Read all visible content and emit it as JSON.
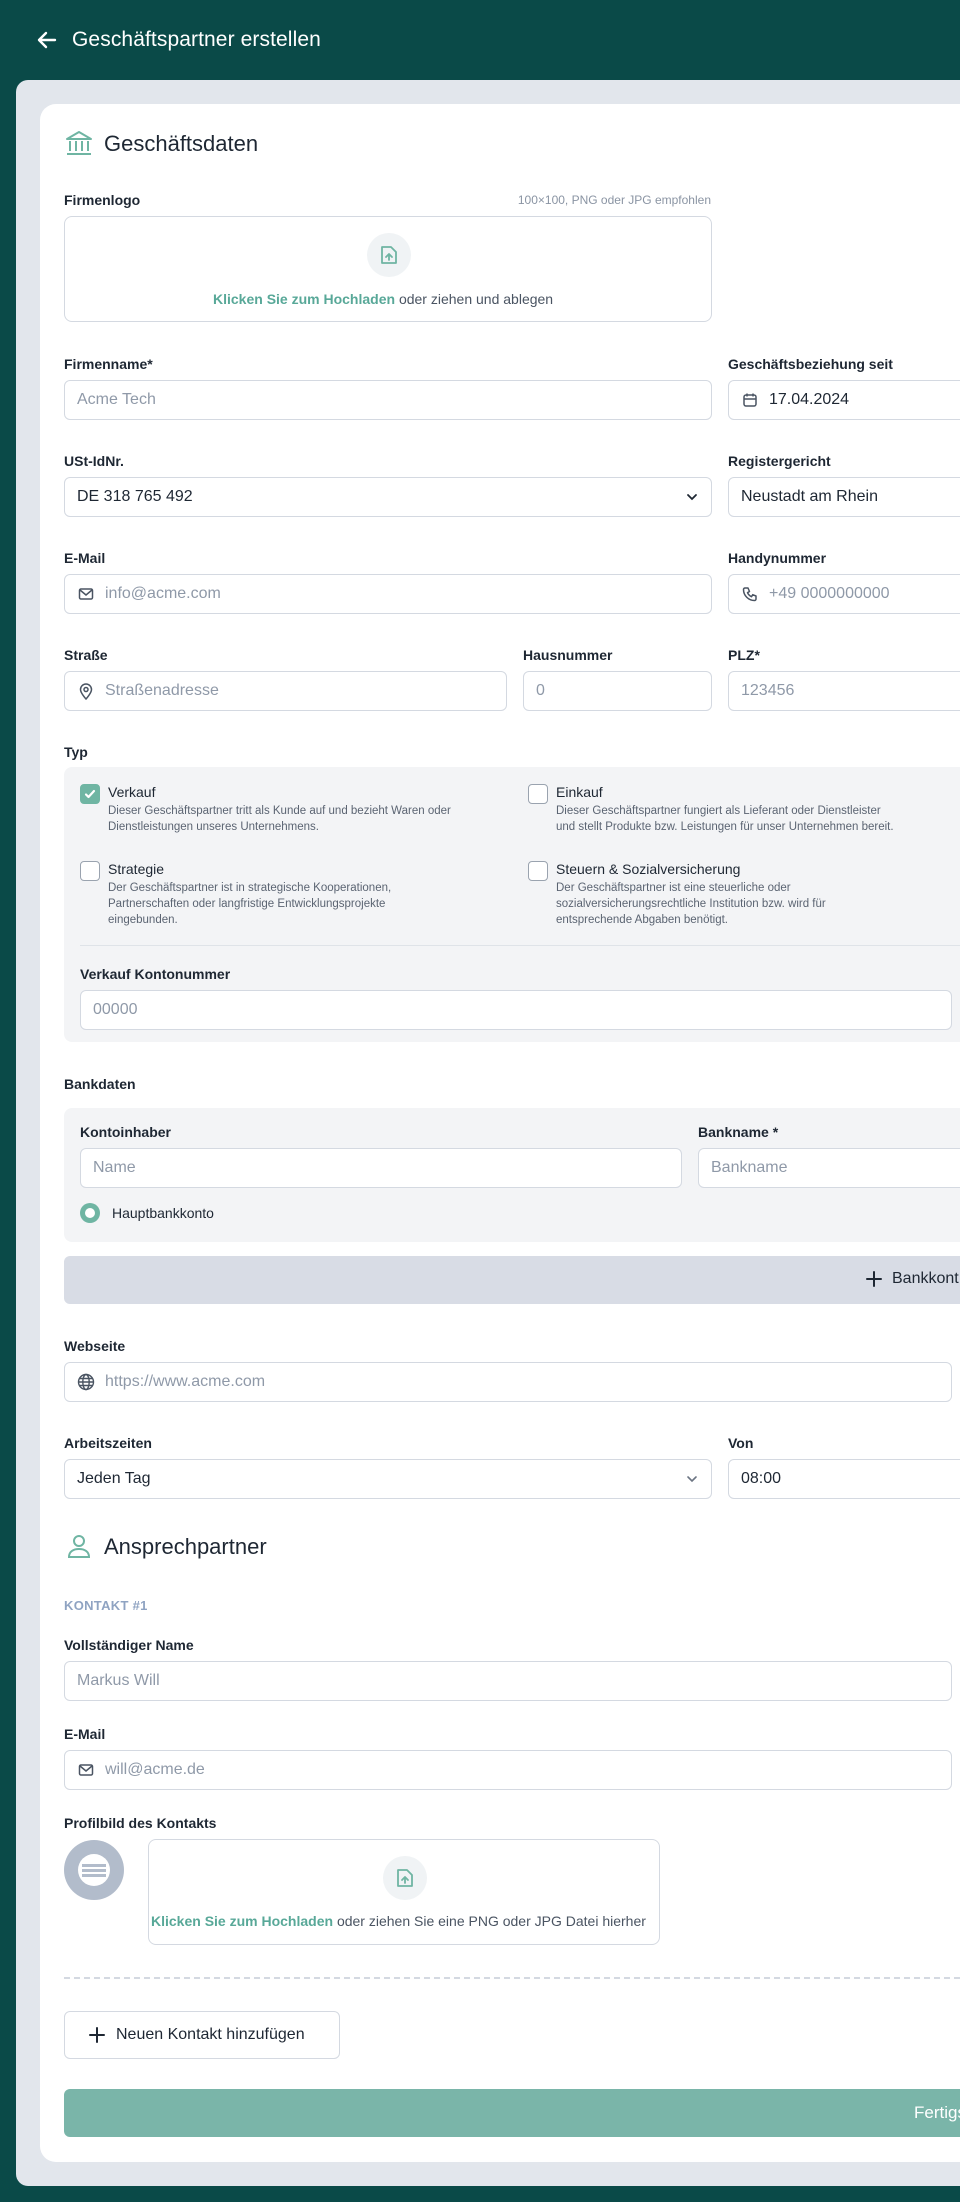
{
  "header": {
    "title": "Geschäftspartner erstellen"
  },
  "business": {
    "section_title": "Geschäftsdaten",
    "logo": {
      "label": "Firmenlogo",
      "hint": "100×100, PNG oder JPG empfohlen",
      "link": "Klicken Sie zum Hochladen",
      "text": " oder ziehen und ablegen"
    },
    "company_name": {
      "label": "Firmenname*",
      "placeholder": "Acme Tech"
    },
    "relation_since": {
      "label": "Geschäftsbeziehung seit",
      "value": "17.04.2024"
    },
    "vat": {
      "label": "USt-IdNr.",
      "value": "DE 318 765 492"
    },
    "register_court": {
      "label": "Registergericht",
      "value": "Neustadt am Rhein"
    },
    "email": {
      "label": "E-Mail",
      "placeholder": "info@acme.com"
    },
    "mobile": {
      "label": "Handynummer",
      "placeholder": "+49 0000000000"
    },
    "street": {
      "label": "Straße",
      "placeholder": "Straßenadresse"
    },
    "house_number": {
      "label": "Hausnummer",
      "placeholder": "0"
    },
    "zip": {
      "label": "PLZ*",
      "placeholder": "123456"
    }
  },
  "type": {
    "label": "Typ",
    "options": [
      {
        "name": "Verkauf",
        "checked": true,
        "desc1": "Dieser Geschäftspartner tritt als Kunde auf und bezieht Waren oder",
        "desc2": "Dienstleistungen unseres Unternehmens.",
        "desc3": ""
      },
      {
        "name": "Einkauf",
        "checked": false,
        "desc1": "Dieser Geschäftspartner fungiert als Lieferant oder Dienstleister",
        "desc2": "und stellt Produkte bzw. Leistungen für unser Unternehmen bereit.",
        "desc3": ""
      },
      {
        "name": "Strategie",
        "checked": false,
        "desc1": "Der Geschäftspartner ist in strategische Kooperationen,",
        "desc2": "Partnerschaften oder langfristige Entwicklungsprojekte",
        "desc3": "eingebunden."
      },
      {
        "name": "Steuern & Sozialversicherung",
        "checked": false,
        "desc1": "Der Geschäftspartner ist eine steuerliche oder",
        "desc2": "sozialversicherungsrechtliche Institution bzw. wird für",
        "desc3": "entsprechende Abgaben benötigt."
      }
    ],
    "account": {
      "label": "Verkauf Kontonummer",
      "placeholder": "00000"
    }
  },
  "bank": {
    "label": "Bankdaten",
    "holder": {
      "label": "Kontoinhaber",
      "placeholder": "Name"
    },
    "bank_name": {
      "label": "Bankname *",
      "placeholder": "Bankname"
    },
    "main_account": "Hauptbankkonto",
    "add_label": "Bankkont"
  },
  "website": {
    "label": "Webseite",
    "placeholder": "https://www.acme.com"
  },
  "hours": {
    "label": "Arbeitszeiten",
    "value": "Jeden Tag",
    "from_label": "Von",
    "from_value": "08:00"
  },
  "contacts": {
    "section_title": "Ansprechpartner",
    "contact_header": "KONTAKT #1",
    "name": {
      "label": "Vollständiger Name",
      "placeholder": "Markus Will"
    },
    "email": {
      "label": "E-Mail",
      "placeholder": "will@acme.de"
    },
    "photo": {
      "label": "Profilbild des Kontakts",
      "link": "Klicken Sie zum Hochladen",
      "text": " oder ziehen Sie eine PNG oder JPG Datei hierher"
    },
    "add_contact": "Neuen Kontakt hinzufügen"
  },
  "footer": {
    "submit": "Fertigs"
  },
  "colors": {
    "header_bg": "#0a4a48",
    "accent": "#6fb5a3",
    "submit_bg": "#7ab5a9"
  }
}
